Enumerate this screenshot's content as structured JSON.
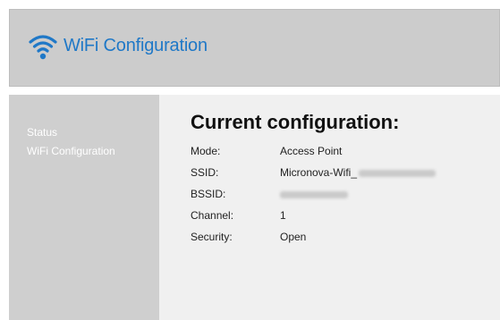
{
  "header": {
    "title": "WiFi Configuration",
    "icon": "wifi-icon",
    "icon_color": "#1f78c7",
    "background": "#cccccc"
  },
  "sidebar": {
    "items": [
      {
        "label": "Status"
      },
      {
        "label": "WiFi Configuration"
      }
    ]
  },
  "main": {
    "heading": "Current configuration:",
    "rows": [
      {
        "label": "Mode:",
        "value": "Access Point"
      },
      {
        "label": "SSID:",
        "value": "Micronova-Wifi_"
      },
      {
        "label": "BSSID:",
        "value": ""
      },
      {
        "label": "Channel:",
        "value": "1"
      },
      {
        "label": "Security:",
        "value": "Open"
      }
    ]
  },
  "colors": {
    "accent": "#1f78c7",
    "sidebar_bg": "#cfcfcf",
    "main_bg": "#f0f0f0"
  }
}
